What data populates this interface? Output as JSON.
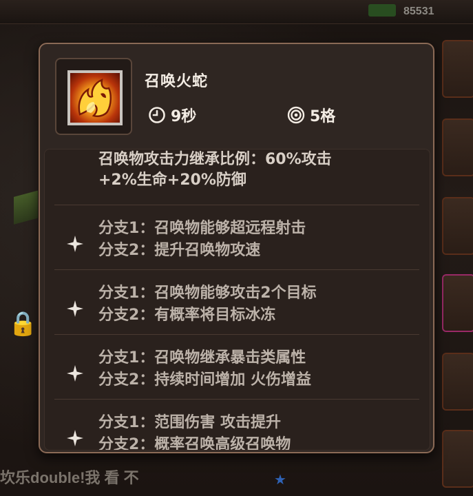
{
  "background": {
    "score": "85531",
    "bottom_text": "坎乐double!我 看 不"
  },
  "skill": {
    "name": "召唤火蛇",
    "duration": "9秒",
    "range": "5格",
    "icon": "fire-serpent-icon"
  },
  "inherit_text": {
    "line1": "召唤物攻击力继承比例：60%攻击",
    "line2": "+2%生命+20%防御"
  },
  "branches": [
    {
      "line1": "分支1：召唤物能够超远程射击",
      "line2": "分支2：提升召唤物攻速"
    },
    {
      "line1": "分支1：召唤物能够攻击2个目标",
      "line2": "分支2：有概率将目标冰冻"
    },
    {
      "line1": "分支1：召唤物继承暴击类属性",
      "line2": "分支2：持续时间增加 火伤增益"
    },
    {
      "line1": "分支1：范围伤害 攻击提升",
      "line2": "分支2：概率召唤高级召唤物"
    }
  ],
  "colors": {
    "panel_bg": "#2f2622",
    "panel_border": "#8a6a56",
    "title_text": "#f3ece4",
    "body_text": "#bcb2a9"
  }
}
